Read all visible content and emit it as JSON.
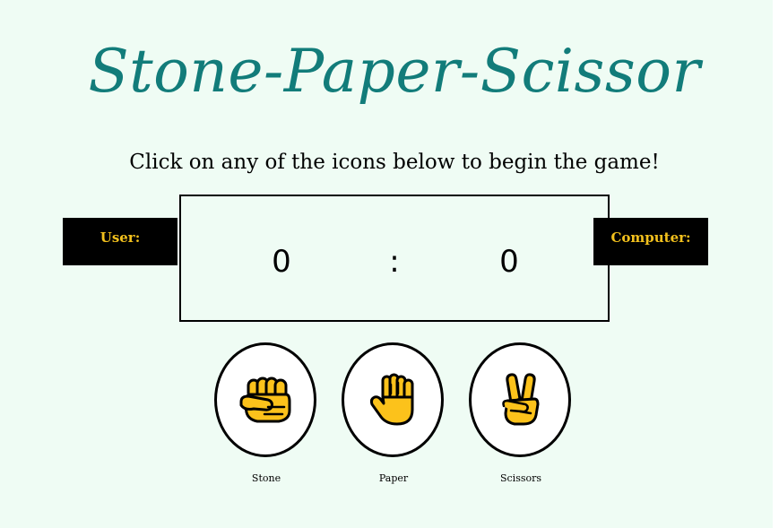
{
  "title": "Stone-Paper-Scissor",
  "instruction": "Click on any of the icons below to begin the game!",
  "scoreboard": {
    "user_label": "User:",
    "computer_label": "Computer:",
    "user_score": "0",
    "separator": ":",
    "computer_score": "0"
  },
  "choices": [
    {
      "label": "Stone",
      "icon": "fist-icon"
    },
    {
      "label": "Paper",
      "icon": "raised-hand-icon"
    },
    {
      "label": "Scissors",
      "icon": "victory-hand-icon"
    }
  ],
  "colors": {
    "background": "#effcf4",
    "title": "#127c7a",
    "badge_background": "#000000",
    "badge_text": "#f2c01d",
    "icon_fill": "#fcc21b"
  }
}
